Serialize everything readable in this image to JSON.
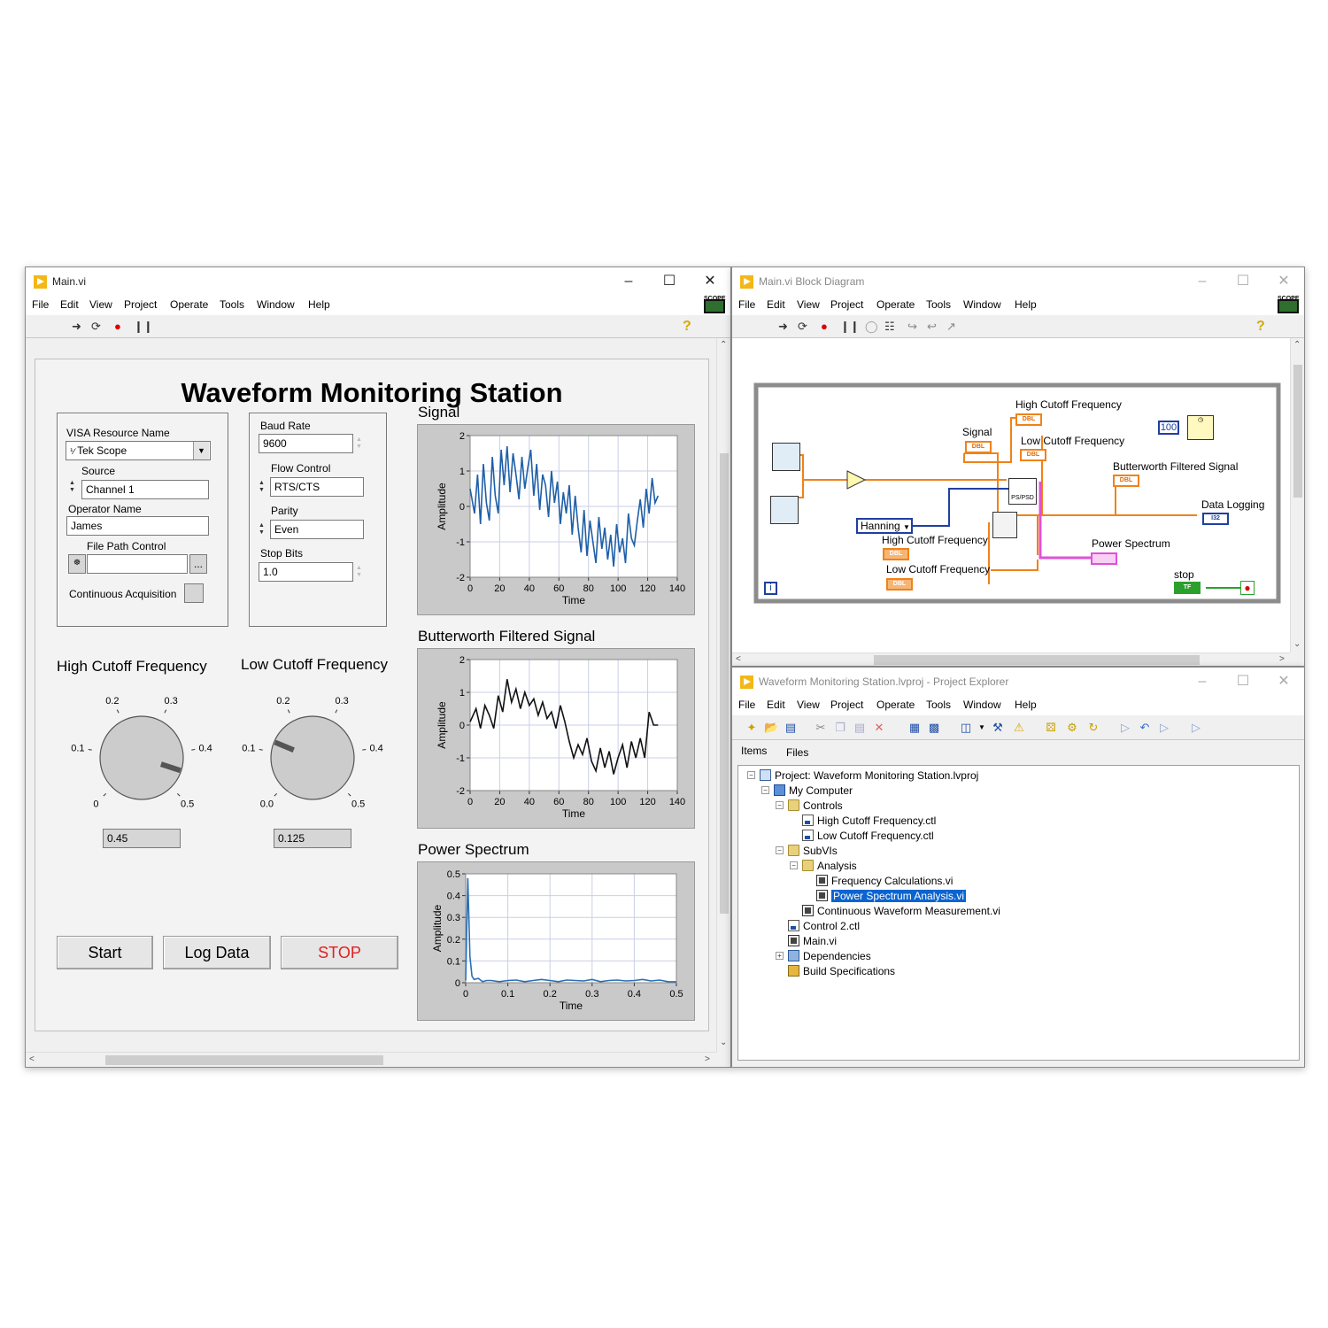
{
  "front_panel": {
    "window_title": "Main.vi",
    "menu": [
      "File",
      "Edit",
      "View",
      "Project",
      "Operate",
      "Tools",
      "Window",
      "Help"
    ],
    "scope_label": "SCOPE",
    "heading": "Waveform Monitoring Station",
    "visa_label": "VISA Resource Name",
    "visa_value": "Tek Scope",
    "source_label": "Source",
    "source_value": "Channel 1",
    "operator_label": "Operator Name",
    "operator_value": "James",
    "filepath_label": "File Path Control",
    "filepath_value": "",
    "filepath_browse": "...",
    "continuous_label": "Continuous Acquisition",
    "baud_label": "Baud Rate",
    "baud_value": "9600",
    "flow_label": "Flow Control",
    "flow_value": "RTS/CTS",
    "parity_label": "Parity",
    "parity_value": "Even",
    "stopbits_label": "Stop Bits",
    "stopbits_value": "1.0",
    "high_knob": {
      "title": "High Cutoff Frequency",
      "ticks": [
        "0",
        "0.1",
        "0.2",
        "0.3",
        "0.4",
        "0.5"
      ],
      "value": 0.45,
      "value_text": "0.45"
    },
    "low_knob": {
      "title": "Low Cutoff Frequency",
      "ticks": [
        "0.0",
        "0.1",
        "0.2",
        "0.3",
        "0.4",
        "0.5"
      ],
      "value": 0.125,
      "value_text": "0.125"
    },
    "buttons": {
      "start": "Start",
      "log": "Log Data",
      "stop": "STOP"
    },
    "colors": {
      "stop_text": "#e02020",
      "signal_line": "#1f5fa8",
      "filtered_line": "#111111",
      "spectrum_line": "#2a6fb6",
      "plot_bg": "#ffffff",
      "grid": "#c9cfe6"
    }
  },
  "chart_data": [
    {
      "type": "line",
      "title": "Signal",
      "xlabel": "Time",
      "ylabel": "Amplitude",
      "xlim": [
        0,
        140
      ],
      "ylim": [
        -2,
        2
      ],
      "xticks": [
        "0",
        "20",
        "40",
        "60",
        "80",
        "100",
        "120",
        "140"
      ],
      "yticks": [
        "2",
        "1",
        "0",
        "-1",
        "-2"
      ],
      "series": [
        {
          "x": [
            0,
            3,
            5,
            7,
            9,
            11,
            13,
            15,
            17,
            19,
            21,
            23,
            25,
            27,
            29,
            31,
            33,
            35,
            37,
            39,
            41,
            43,
            45,
            47,
            49,
            51,
            53,
            55,
            57,
            59,
            61,
            63,
            65,
            67,
            69,
            71,
            73,
            75,
            77,
            79,
            81,
            83,
            85,
            87,
            89,
            91,
            93,
            95,
            97,
            99,
            101,
            103,
            105,
            107,
            109,
            111,
            113,
            115,
            117,
            119,
            121,
            123,
            125,
            127
          ],
          "y": [
            0.5,
            -0.2,
            0.9,
            -0.5,
            1.2,
            0.1,
            -0.4,
            1.4,
            0.3,
            -0.2,
            1.6,
            0.6,
            1.7,
            0.4,
            1.5,
            0.9,
            0.2,
            1.4,
            0.5,
            1.1,
            1.6,
            0.3,
            1.2,
            -0.1,
            0.9,
            0.6,
            -0.3,
            1.0,
            0.1,
            0.7,
            -0.5,
            0.4,
            -0.2,
            0.6,
            -0.8,
            0.3,
            -0.6,
            -1.3,
            -0.1,
            -1.4,
            -0.4,
            -1.0,
            -1.6,
            -0.3,
            -1.2,
            -0.6,
            -1.5,
            -0.8,
            -1.7,
            -0.5,
            -1.3,
            -0.9,
            -1.6,
            -0.2,
            -0.9,
            -1.1,
            -0.4,
            0.2,
            -0.6,
            0.5,
            -0.2,
            0.8,
            0.1,
            0.3
          ]
        }
      ]
    },
    {
      "type": "line",
      "title": "Butterworth Filtered Signal",
      "xlabel": "Time",
      "ylabel": "Amplitude",
      "xlim": [
        0,
        140
      ],
      "ylim": [
        -2,
        2
      ],
      "xticks": [
        "0",
        "20",
        "40",
        "60",
        "80",
        "100",
        "120",
        "140"
      ],
      "yticks": [
        "2",
        "1",
        "0",
        "-1",
        "-2"
      ],
      "series": [
        {
          "x": [
            0,
            4,
            7,
            10,
            13,
            16,
            19,
            22,
            25,
            28,
            31,
            34,
            37,
            40,
            43,
            46,
            49,
            52,
            55,
            58,
            61,
            64,
            67,
            70,
            73,
            76,
            79,
            82,
            85,
            88,
            91,
            94,
            97,
            100,
            103,
            106,
            109,
            112,
            115,
            118,
            121,
            124,
            127
          ],
          "y": [
            0.1,
            0.5,
            -0.1,
            0.6,
            0.3,
            -0.1,
            0.9,
            0.4,
            1.4,
            0.7,
            1.1,
            0.5,
            1.0,
            0.6,
            0.8,
            0.3,
            0.7,
            0.2,
            0.4,
            -0.1,
            0.6,
            0.1,
            -0.5,
            -1.0,
            -0.6,
            -0.9,
            -0.4,
            -1.1,
            -1.4,
            -0.7,
            -1.3,
            -0.8,
            -1.5,
            -1.0,
            -0.6,
            -1.3,
            -0.5,
            -1.0,
            -0.4,
            -1.0,
            0.4,
            0.0,
            0.0
          ]
        }
      ]
    },
    {
      "type": "line",
      "title": "Power Spectrum",
      "xlabel": "Time",
      "ylabel": "Amplitude",
      "xlim": [
        0,
        0.5
      ],
      "ylim": [
        0,
        0.5
      ],
      "xticks": [
        "0",
        "0.1",
        "0.2",
        "0.3",
        "0.4",
        "0.5"
      ],
      "yticks": [
        "0.5",
        "0.4",
        "0.3",
        "0.2",
        "0.1",
        "0"
      ],
      "series": [
        {
          "x": [
            0,
            0.005,
            0.01,
            0.015,
            0.02,
            0.03,
            0.04,
            0.05,
            0.06,
            0.08,
            0.1,
            0.12,
            0.14,
            0.16,
            0.18,
            0.2,
            0.22,
            0.24,
            0.26,
            0.28,
            0.3,
            0.32,
            0.34,
            0.36,
            0.38,
            0.4,
            0.42,
            0.44,
            0.46,
            0.48,
            0.5
          ],
          "y": [
            0.01,
            0.48,
            0.12,
            0.03,
            0.015,
            0.02,
            0.005,
            0.01,
            0.01,
            0.005,
            0.01,
            0.012,
            0.005,
            0.01,
            0.015,
            0.01,
            0.005,
            0.012,
            0.01,
            0.008,
            0.015,
            0.005,
            0.01,
            0.012,
            0.008,
            0.01,
            0.015,
            0.008,
            0.012,
            0.005,
            0.004
          ]
        }
      ]
    }
  ],
  "block_diagram": {
    "window_title": "Main.vi Block Diagram",
    "menu": [
      "File",
      "Edit",
      "View",
      "Project",
      "Operate",
      "Tools",
      "Window",
      "Help"
    ],
    "scope_label": "SCOPE",
    "labels": {
      "signal": "Signal",
      "high_cutoff_top": "High Cutoff Frequency",
      "low_cutoff_top": "Low Cutoff Frequency",
      "filtered": "Butterworth Filtered Signal",
      "data_logging": "Data Logging",
      "hanning": "Hanning",
      "high_cutoff_in": "High Cutoff Frequency",
      "low_cutoff_in": "Low Cutoff Frequency",
      "power_spectrum": "Power Spectrum",
      "stop": "stop",
      "wait_value": "100",
      "dbl": "DBL",
      "i32": "I32",
      "tf": "TF",
      "pspsd": "PS/PSD",
      "info": "i"
    }
  },
  "project_explorer": {
    "window_title": "Waveform Monitoring Station.lvproj - Project Explorer",
    "menu": [
      "File",
      "Edit",
      "View",
      "Project",
      "Operate",
      "Tools",
      "Window",
      "Help"
    ],
    "tabs": [
      "Items",
      "Files"
    ],
    "tree": [
      {
        "text": "Project: Waveform Monitoring Station.lvproj",
        "level": 0,
        "icon": "proj"
      },
      {
        "text": "My Computer",
        "level": 1,
        "icon": "computer"
      },
      {
        "text": "Controls",
        "level": 2,
        "icon": "folder"
      },
      {
        "text": "High Cutoff Frequency.ctl",
        "level": 3,
        "icon": "file"
      },
      {
        "text": "Low Cutoff Frequency.ctl",
        "level": 3,
        "icon": "file"
      },
      {
        "text": "SubVIs",
        "level": 2,
        "icon": "folder"
      },
      {
        "text": "Analysis",
        "level": 3,
        "icon": "folder"
      },
      {
        "text": "Frequency Calculations.vi",
        "level": 4,
        "icon": "vi"
      },
      {
        "text": "Power Spectrum Analysis.vi",
        "level": 4,
        "icon": "vi",
        "selected": true
      },
      {
        "text": "Continuous Waveform Measurement.vi",
        "level": 3,
        "icon": "vi"
      },
      {
        "text": "Control 2.ctl",
        "level": 2,
        "icon": "file"
      },
      {
        "text": "Main.vi",
        "level": 2,
        "icon": "vi"
      },
      {
        "text": "Dependencies",
        "level": 2,
        "icon": "deps"
      },
      {
        "text": "Build Specifications",
        "level": 2,
        "icon": "build"
      }
    ]
  }
}
